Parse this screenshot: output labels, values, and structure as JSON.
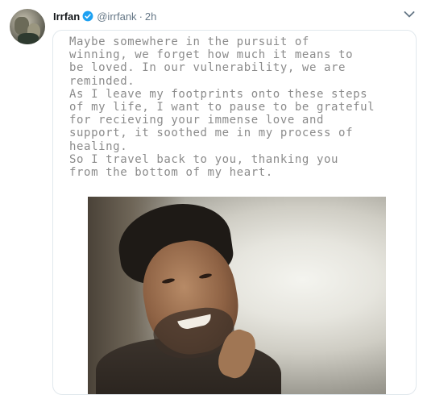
{
  "tweet": {
    "author_name": "Irrfan",
    "author_handle": "@irrfank",
    "separator": "·",
    "timestamp": "2h",
    "verified": true,
    "caret_icon": "chevron-down-icon",
    "colors": {
      "name": "#14171a",
      "meta": "#657786",
      "verified": "#1da1f2",
      "card_border": "#e1e8ed",
      "note_text": "#8b8b8b"
    },
    "note_lines": [
      "Maybe somewhere in the pursuit of",
      "winning, we forget how much it means to",
      "be loved. In our vulnerability, we are",
      "reminded.",
      "As I leave my footprints onto these steps",
      "of my life, I want to pause to be grateful",
      "for recieving your immense love and",
      "support, it soothed me in my process of",
      "healing.",
      "So I travel  back to you, thanking you",
      "from the bottom of my heart."
    ]
  }
}
